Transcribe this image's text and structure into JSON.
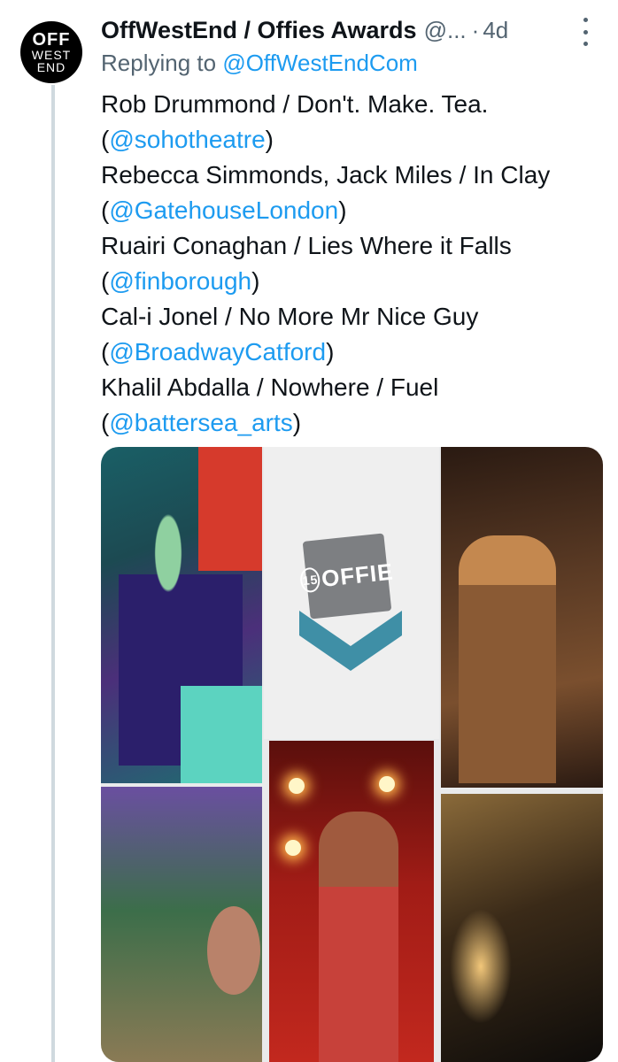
{
  "tweet": {
    "avatar_lines": [
      "OFF",
      "WEST",
      "END"
    ],
    "author_name": "OffWestEnd / Offies Awards",
    "author_handle": "@...",
    "separator": "·",
    "timestamp": "4d",
    "replying_to_label": "Replying to",
    "replying_to_handle": "@OffWestEndCom",
    "lines": [
      {
        "text": "Rob Drummond / Don't. Make. Tea."
      },
      {
        "open": "(",
        "handle": "@sohotheatre",
        "close": ")"
      },
      {
        "text": "Rebecca Simmonds, Jack Miles / In Clay"
      },
      {
        "open": "(",
        "handle": "@GatehouseLondon",
        "close": ")"
      },
      {
        "text": "Ruairi Conaghan / Lies Where it Falls"
      },
      {
        "open": "(",
        "handle": "@finborough",
        "close": ")"
      },
      {
        "text": "Cal-i Jonel / No More Mr Nice Guy"
      },
      {
        "open": "(",
        "handle": "@BroadwayCatford",
        "close": ")"
      },
      {
        "text": "Khalil Abdalla / Nowhere / Fuel"
      },
      {
        "open": "(",
        "handle": "@battersea_arts",
        "close": ")"
      }
    ],
    "media": {
      "badge_text": "OFFIE",
      "badge_number": "15"
    }
  },
  "colors": {
    "link": "#1d9bf0",
    "secondary_text": "#536471",
    "thread_line": "#cfd9de",
    "chevron": "#3f8fa6"
  }
}
